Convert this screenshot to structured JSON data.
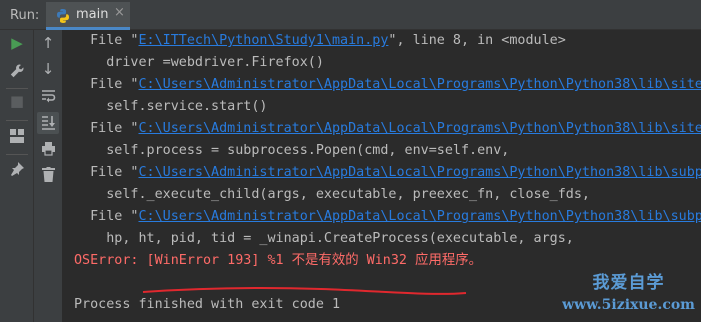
{
  "run_label": "Run:",
  "tab": {
    "title": "main",
    "close": "×"
  },
  "toolbar_left": [
    {
      "name": "rerun-icon",
      "glyph": "▶"
    },
    {
      "name": "wrench-icon",
      "glyph": "🔧"
    },
    {
      "name": "stop-icon",
      "glyph": "■"
    },
    {
      "name": "layout-icon",
      "glyph": "▦"
    },
    {
      "name": "pin-icon",
      "glyph": "📌"
    }
  ],
  "toolbar_right": [
    {
      "name": "up-arrow-icon",
      "glyph": "↑"
    },
    {
      "name": "down-arrow-icon",
      "glyph": "↓"
    },
    {
      "name": "soft-wrap-icon",
      "glyph": "↩"
    },
    {
      "name": "scroll-to-end-icon",
      "glyph": "⤓"
    },
    {
      "name": "print-icon",
      "glyph": "🖶"
    },
    {
      "name": "trash-icon",
      "glyph": "🗑"
    }
  ],
  "console": {
    "lines": [
      {
        "pre": "  File \"",
        "link": "E:\\ITTech\\Python\\Study1\\main.py",
        "post": "\", line 8, in <module>"
      },
      {
        "text": "    driver =webdriver.Firefox()"
      },
      {
        "pre": "  File \"",
        "link": "C:\\Users\\Administrator\\AppData\\Local\\Programs\\Python\\Python38\\lib\\site-",
        "post": ""
      },
      {
        "text": "    self.service.start()"
      },
      {
        "pre": "  File \"",
        "link": "C:\\Users\\Administrator\\AppData\\Local\\Programs\\Python\\Python38\\lib\\site-",
        "post": ""
      },
      {
        "text": "    self.process = subprocess.Popen(cmd, env=self.env,"
      },
      {
        "pre": "  File \"",
        "link": "C:\\Users\\Administrator\\AppData\\Local\\Programs\\Python\\Python38\\lib\\subpr",
        "post": ""
      },
      {
        "text": "    self._execute_child(args, executable, preexec_fn, close_fds,"
      },
      {
        "pre": "  File \"",
        "link": "C:\\Users\\Administrator\\AppData\\Local\\Programs\\Python\\Python38\\lib\\subpr",
        "post": ""
      },
      {
        "text": "    hp, ht, pid, tid = _winapi.CreateProcess(executable, args,"
      }
    ],
    "error_line": "OSError: [WinError 193] %1 不是有效的 Win32 应用程序。",
    "exit_line": "Process finished with exit code 1"
  },
  "watermark": {
    "line1": "我爱自学",
    "line2": "www.5izixue.com"
  },
  "colors": {
    "background": "#2b2b2b",
    "text": "#bbbbbb",
    "error": "#ff6b68",
    "link": "#287bde",
    "annotation": "#e0282e"
  }
}
